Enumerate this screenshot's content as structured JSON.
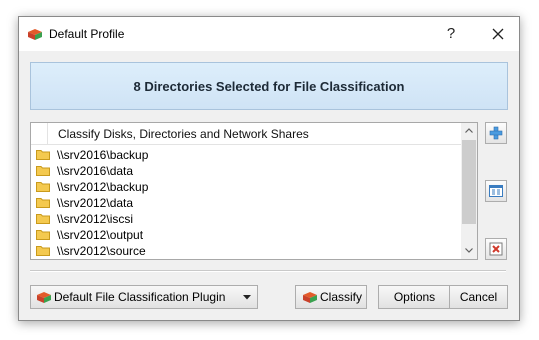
{
  "window": {
    "title": "Default Profile",
    "help_label": "?"
  },
  "banner": {
    "text": "8 Directories Selected for File Classification"
  },
  "directory_list": {
    "header": "Classify Disks, Directories and Network Shares",
    "items": [
      "\\\\srv2016\\backup",
      "\\\\srv2016\\data",
      "\\\\srv2012\\backup",
      "\\\\srv2012\\data",
      "\\\\srv2012\\iscsi",
      "\\\\srv2012\\output",
      "\\\\srv2012\\source"
    ]
  },
  "side_buttons": {
    "add": "add-icon",
    "properties": "properties-icon",
    "remove": "remove-icon"
  },
  "footer": {
    "plugin_selected": "Default File Classification Plugin",
    "classify_label": "Classify",
    "options_label": "Options",
    "cancel_label": "Cancel"
  },
  "colors": {
    "banner_bg": "#d7e9f9",
    "banner_border": "#a9c3dc",
    "folder": "#f4c94f",
    "accent_blue": "#2f7fc9",
    "remove_red": "#d03a2c"
  }
}
